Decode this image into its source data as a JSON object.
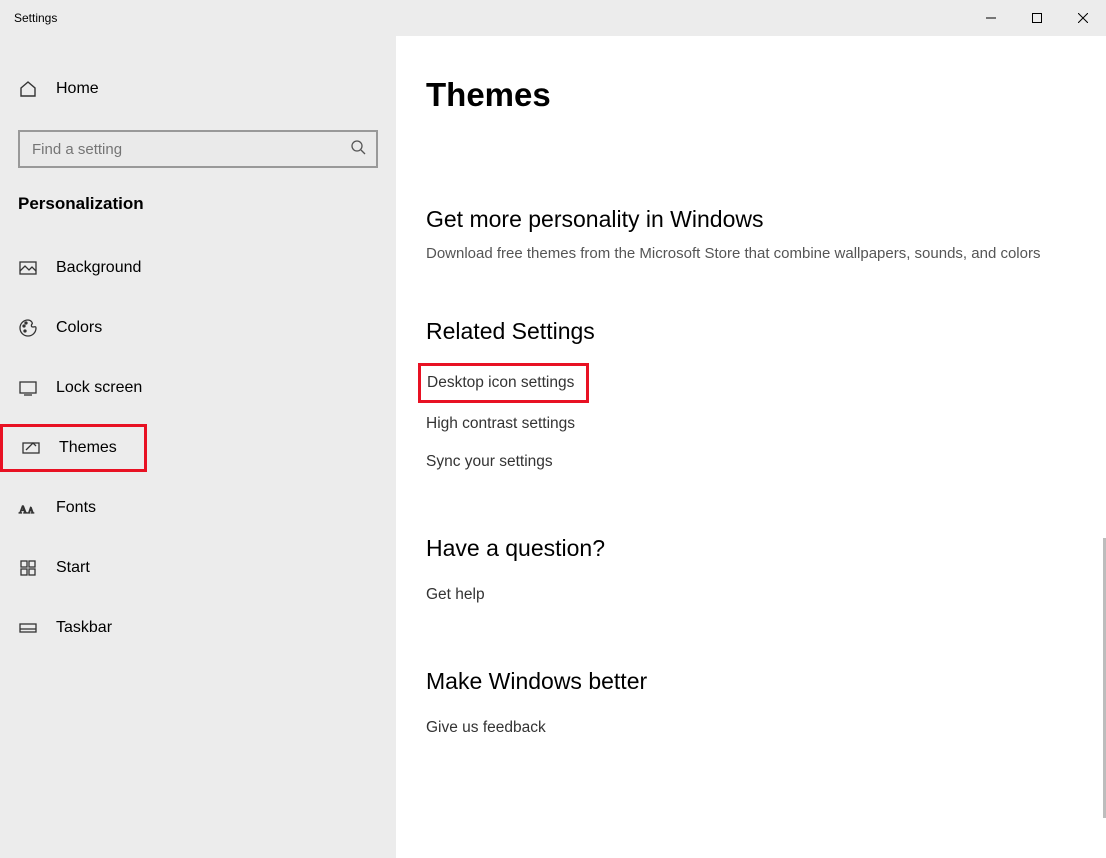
{
  "window": {
    "title": "Settings"
  },
  "sidebar": {
    "home_label": "Home",
    "search_placeholder": "Find a setting",
    "category": "Personalization",
    "items": [
      {
        "label": "Background",
        "icon": "background"
      },
      {
        "label": "Colors",
        "icon": "colors"
      },
      {
        "label": "Lock screen",
        "icon": "lockscreen"
      },
      {
        "label": "Themes",
        "icon": "themes",
        "selected": true
      },
      {
        "label": "Fonts",
        "icon": "fonts"
      },
      {
        "label": "Start",
        "icon": "start"
      },
      {
        "label": "Taskbar",
        "icon": "taskbar"
      }
    ]
  },
  "main": {
    "title": "Themes",
    "sections": {
      "personality": {
        "heading": "Get more personality in Windows",
        "sub": "Download free themes from the Microsoft Store that combine wallpapers, sounds, and colors"
      },
      "related": {
        "heading": "Related Settings",
        "links": [
          "Desktop icon settings",
          "High contrast settings",
          "Sync your settings"
        ]
      },
      "question": {
        "heading": "Have a question?",
        "link": "Get help"
      },
      "better": {
        "heading": "Make Windows better",
        "link": "Give us feedback"
      }
    }
  }
}
